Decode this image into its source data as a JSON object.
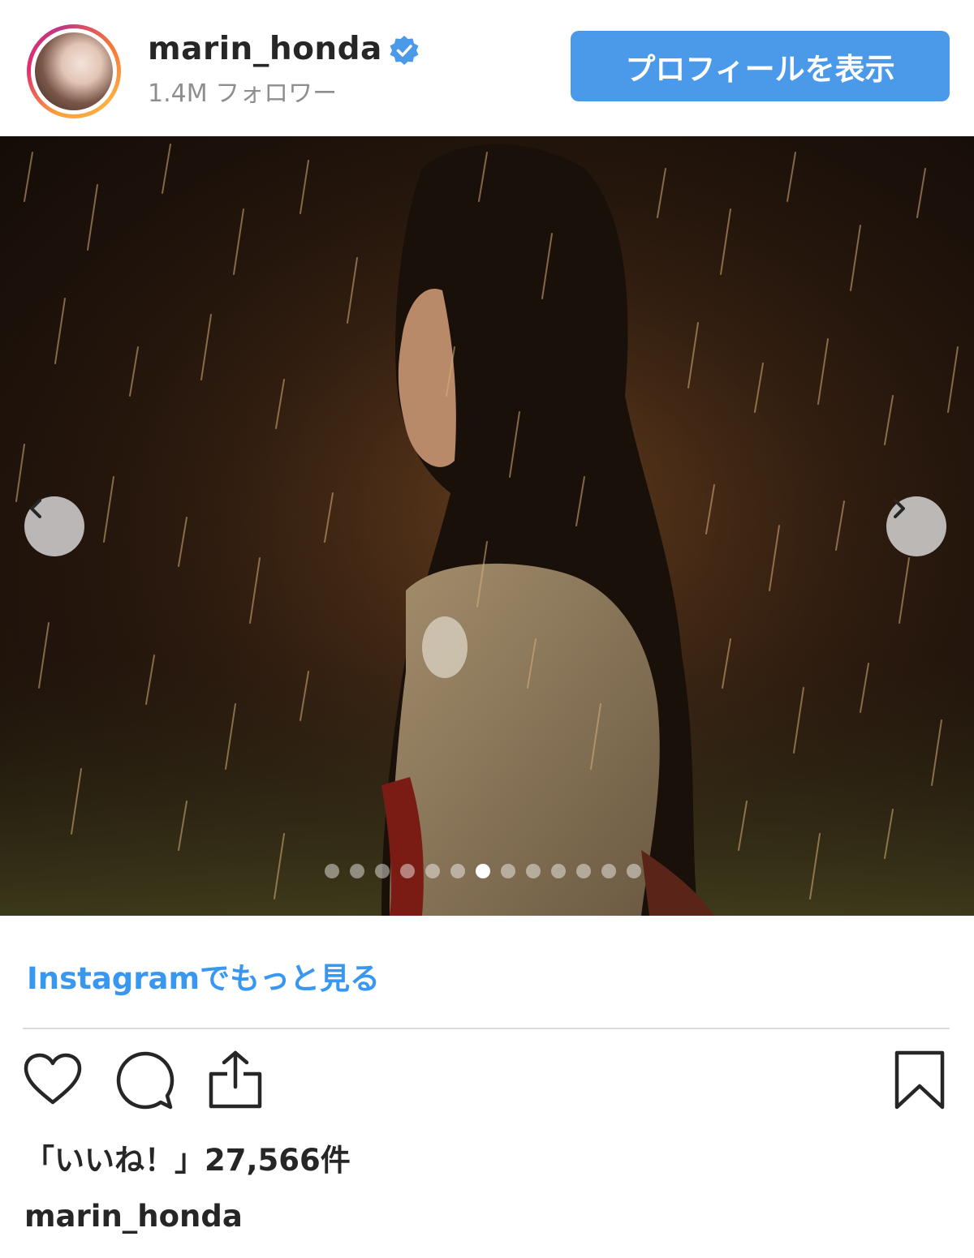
{
  "header": {
    "username": "marin_honda",
    "followers": "1.4M フォロワー",
    "profile_button": "プロフィールを表示",
    "verified_icon": "verified-badge-icon"
  },
  "carousel": {
    "slide_count": 13,
    "active_index": 6,
    "prev_icon": "chevron-left-icon",
    "next_icon": "chevron-right-icon"
  },
  "links": {
    "more_on_instagram": "Instagramでもっと見る"
  },
  "actions": {
    "like_icon": "heart-icon",
    "comment_icon": "comment-icon",
    "share_icon": "share-icon",
    "save_icon": "bookmark-icon"
  },
  "likes": {
    "text": "「いいね！」27,566件"
  },
  "caption": {
    "username": "marin_honda"
  },
  "colors": {
    "accent_blue": "#4a9ae9",
    "link_blue": "#3897f0",
    "text": "#262626",
    "muted": "#8e8e8e"
  }
}
